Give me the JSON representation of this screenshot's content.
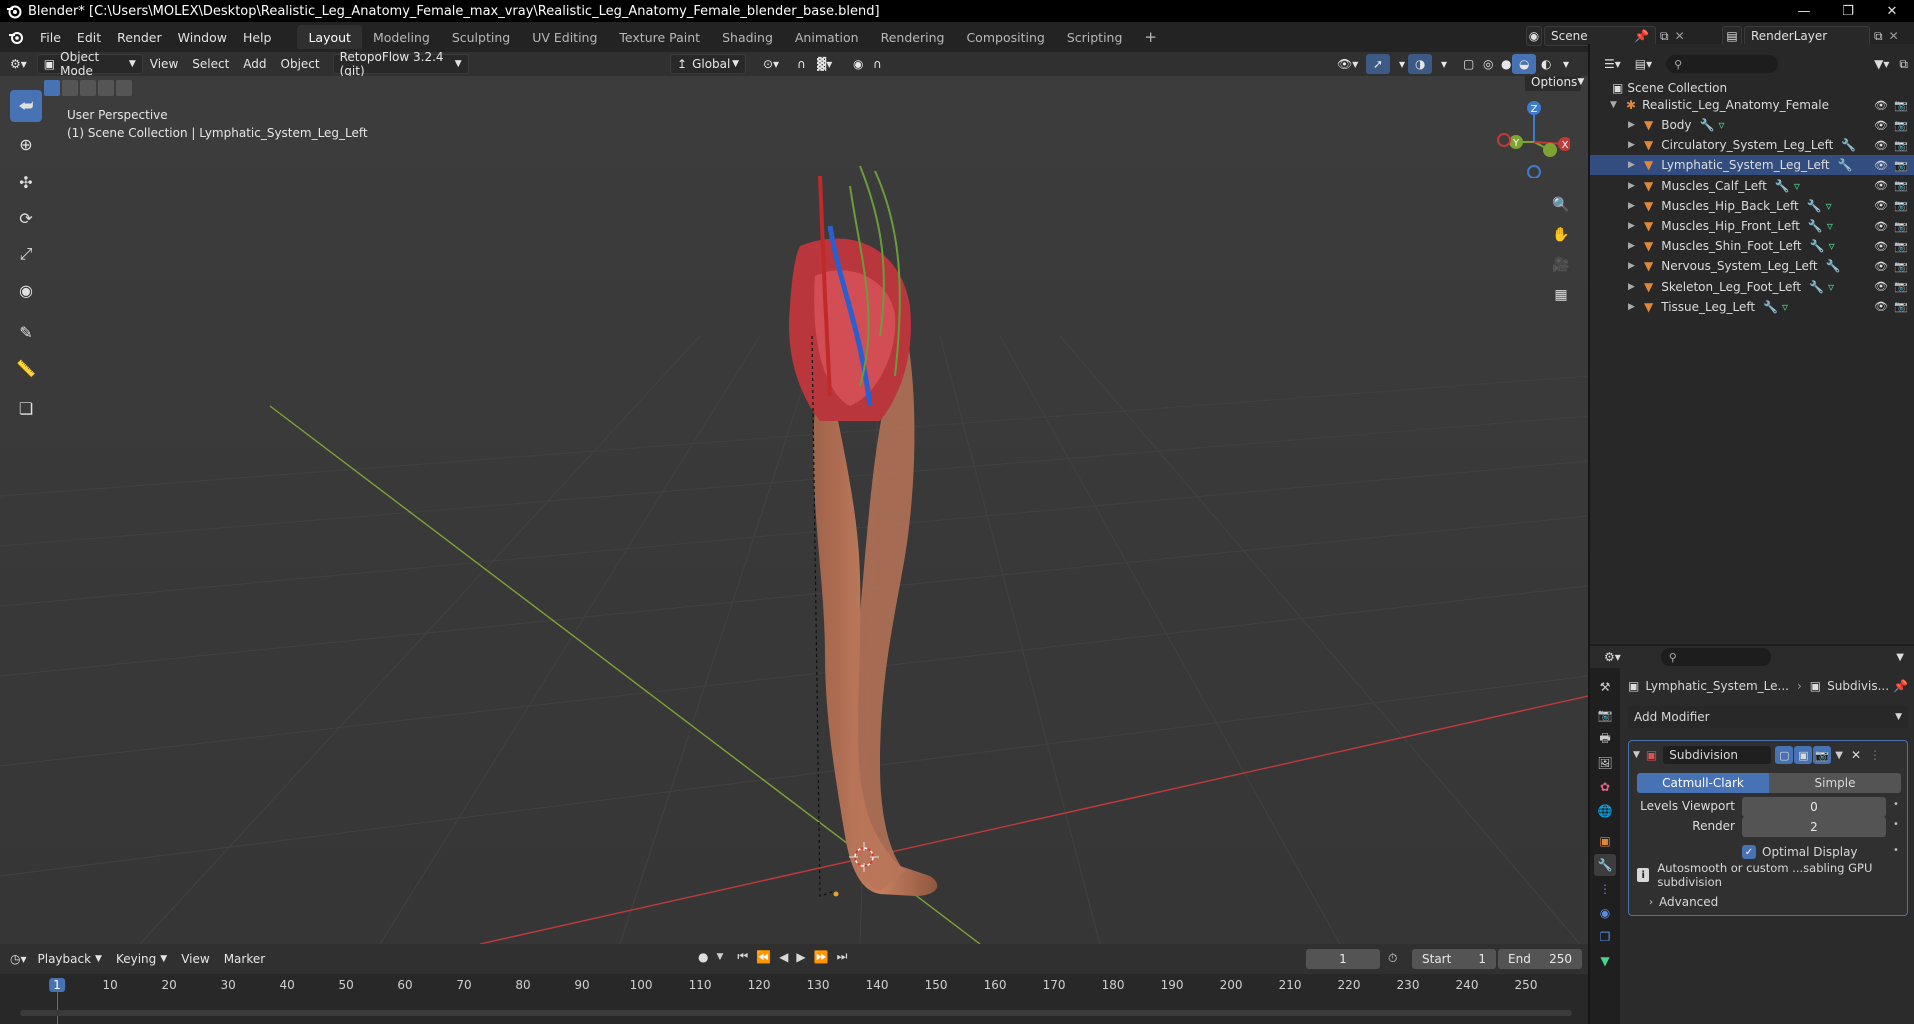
{
  "window": {
    "title": "Blender* [C:\\Users\\MOLEX\\Desktop\\Realistic_Leg_Anatomy_Female_max_vray\\Realistic_Leg_Anatomy_Female_blender_base.blend]"
  },
  "menu": [
    "File",
    "Edit",
    "Render",
    "Window",
    "Help"
  ],
  "workspaces": [
    "Layout",
    "Modeling",
    "Sculpting",
    "UV Editing",
    "Texture Paint",
    "Shading",
    "Animation",
    "Rendering",
    "Compositing",
    "Scripting"
  ],
  "workspace_add": "+",
  "scene": {
    "name": "Scene",
    "render_layer": "RenderLayer"
  },
  "viewport_header": {
    "mode": "Object Mode",
    "menus": [
      "View",
      "Select",
      "Add",
      "Object"
    ],
    "addon": "RetopoFlow 3.2.4 (git)",
    "orientation": "Global",
    "options": "Options"
  },
  "viewport": {
    "perspective": "User Perspective",
    "collection_info": "(1) Scene Collection | Lymphatic_System_Leg_Left",
    "gizmo": {
      "z": "Z",
      "y": "Y",
      "x": "X"
    }
  },
  "outliner": {
    "root": "Scene Collection",
    "collection": "Realistic_Leg_Anatomy_Female",
    "objects": [
      "Body",
      "Circulatory_System_Leg_Left",
      "Lymphatic_System_Leg_Left",
      "Muscles_Calf_Left",
      "Muscles_Hip_Back_Left",
      "Muscles_Hip_Front_Left",
      "Muscles_Shin_Foot_Left",
      "Nervous_System_Leg_Left",
      "Skeleton_Leg_Foot_Left",
      "Tissue_Leg_Left"
    ],
    "selected_index": 2
  },
  "properties": {
    "breadcrumb_object": "Lymphatic_System_Le...",
    "breadcrumb_modifier": "Subdivis...",
    "add_modifier": "Add Modifier",
    "modifier": {
      "name": "Subdivision",
      "method_catmull": "Catmull-Clark",
      "method_simple": "Simple",
      "levels_viewport_label": "Levels Viewport",
      "levels_viewport_value": "0",
      "render_label": "Render",
      "render_value": "2",
      "optimal_display": "Optimal Display",
      "info": "Autosmooth or custom ...sabling GPU subdivision",
      "advanced": "Advanced"
    }
  },
  "timeline": {
    "menus": [
      "Playback",
      "Keying",
      "View",
      "Marker"
    ],
    "current_frame": "1",
    "start_label": "Start",
    "start_value": "1",
    "end_label": "End",
    "end_value": "250",
    "ticks": [
      "1",
      "10",
      "20",
      "30",
      "40",
      "50",
      "60",
      "70",
      "80",
      "90",
      "100",
      "110",
      "120",
      "130",
      "140",
      "150",
      "160",
      "170",
      "180",
      "190",
      "200",
      "210",
      "220",
      "230",
      "240",
      "250"
    ]
  },
  "colors": {
    "accent": "#4772b3",
    "x_axis": "#c03a3a",
    "y_axis": "#7ea332",
    "z_axis": "#3e7bd0",
    "object_orange": "#e0883a"
  }
}
